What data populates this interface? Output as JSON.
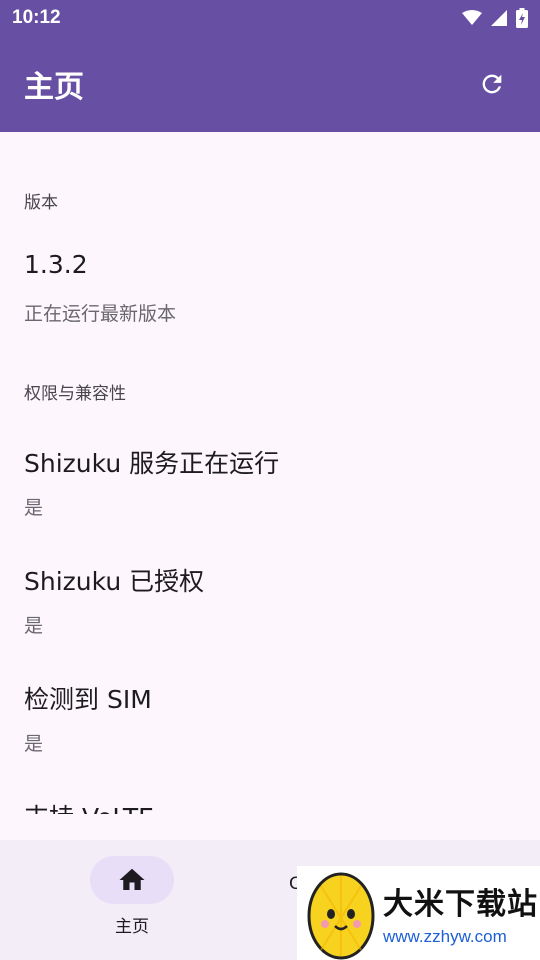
{
  "status_bar": {
    "time": "10:12",
    "icons": [
      "wifi-icon",
      "signal-icon",
      "battery-charging-icon"
    ]
  },
  "app_bar": {
    "title": "主页",
    "action_icon": "refresh-icon"
  },
  "sections": {
    "version": {
      "header": "版本",
      "value": "1.3.2",
      "status": "正在运行最新版本"
    },
    "compat": {
      "header": "权限与兼容性",
      "items": [
        {
          "title": "Shizuku 服务正在运行",
          "value": "是"
        },
        {
          "title": "Shizuku 已授权",
          "value": "是"
        },
        {
          "title": "检测到 SIM",
          "value": "是"
        },
        {
          "title": "支持 VoLTE"
        }
      ]
    }
  },
  "bottom_nav": {
    "items": [
      {
        "label": "主页",
        "icon": "home-icon",
        "selected": true
      },
      {
        "label": "C",
        "icon": ""
      }
    ]
  },
  "watermark": {
    "title": "大米下载站",
    "url": "www.zzhyw.com"
  },
  "colors": {
    "primary": "#6750a4",
    "background": "#fdf7fd",
    "nav_bg": "#f3edf7",
    "indicator": "#e8def8"
  }
}
